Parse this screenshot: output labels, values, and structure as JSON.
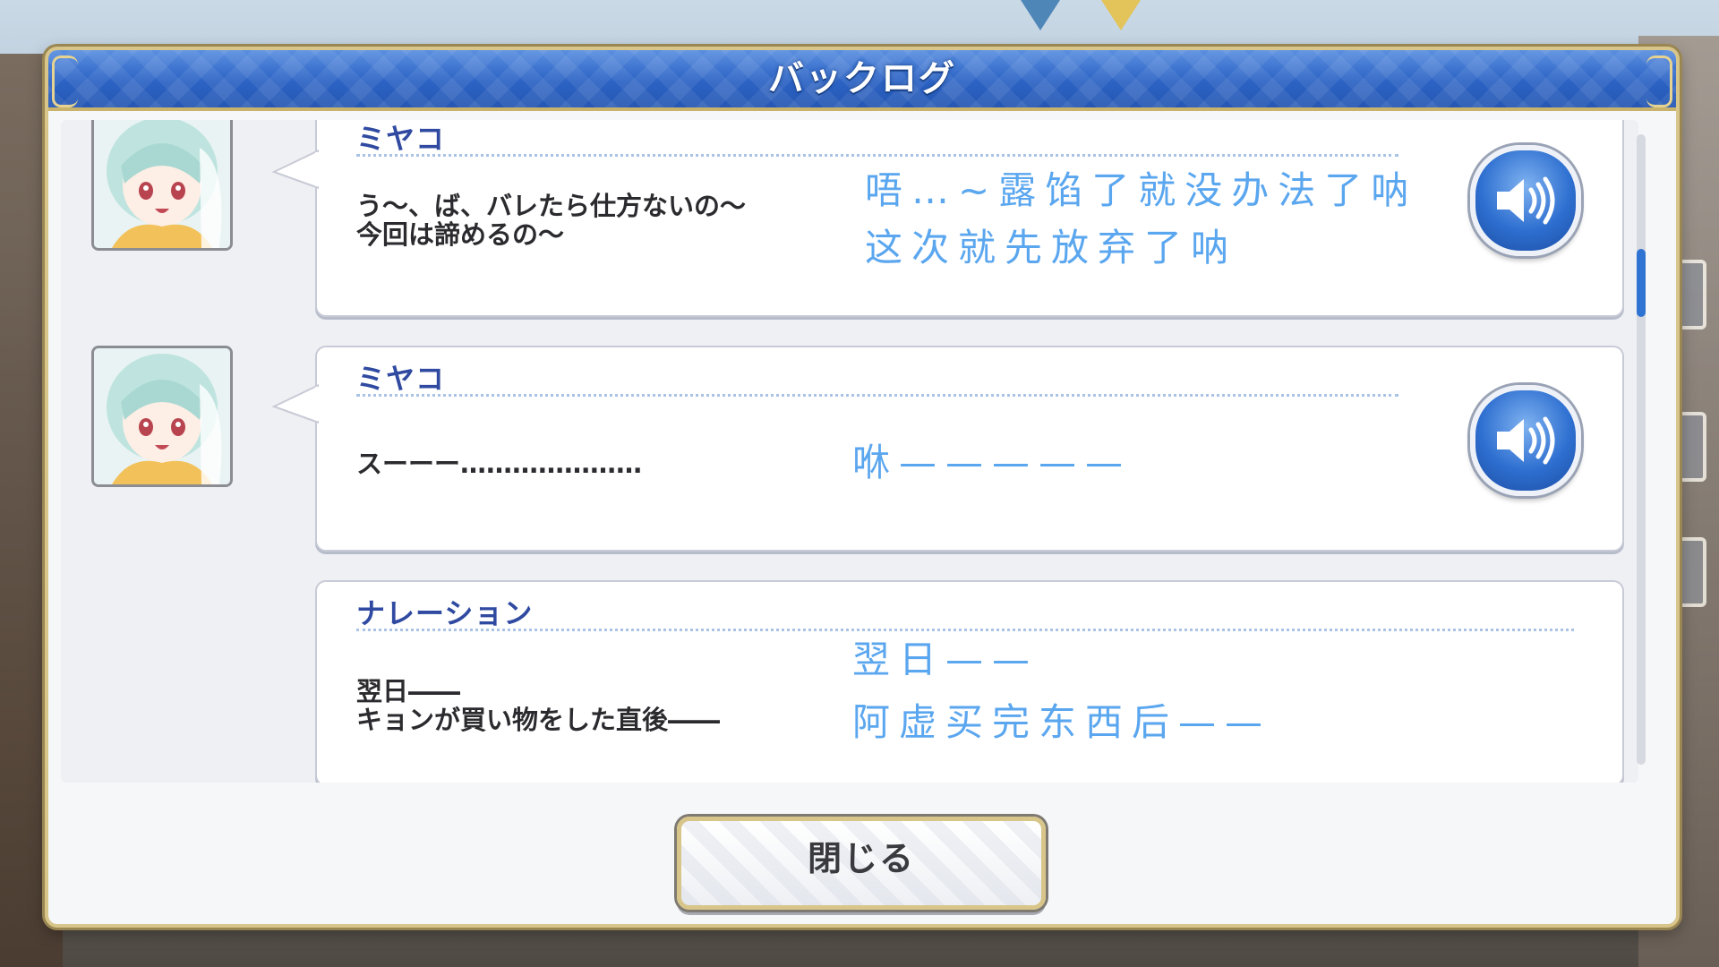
{
  "window": {
    "title": "バックログ"
  },
  "entries": [
    {
      "speaker": "ミヤコ",
      "text_line1": "う～、ば、バレたら仕方ないの～",
      "text_line2": "今回は諦めるの～",
      "translation_line1": "唔…~露馅了就没办法了呐",
      "translation_line2": "这次就先放弃了呐",
      "has_avatar": true,
      "has_voice": true,
      "voice_icon": "speaker-volume-icon"
    },
    {
      "speaker": "ミヤコ",
      "text_line1": "スーーー…………………",
      "text_line2": "",
      "translation_line1": "咻—————",
      "translation_line2": "",
      "has_avatar": true,
      "has_voice": true,
      "voice_icon": "speaker-volume-icon"
    },
    {
      "speaker": "ナレーション",
      "text_line1": "翌日――",
      "text_line2": "キョンが買い物をした直後――",
      "translation_line1": "翌日——",
      "translation_line2": "阿虚买完东西后——",
      "has_avatar": false,
      "has_voice": false
    }
  ],
  "footer": {
    "close_label": "閉じる"
  },
  "colors": {
    "title_bar": "#2c63c4",
    "speaker_name": "#2f4aa0",
    "translation_text": "#5aa6ef",
    "frame_gold": "#d7c58a"
  }
}
